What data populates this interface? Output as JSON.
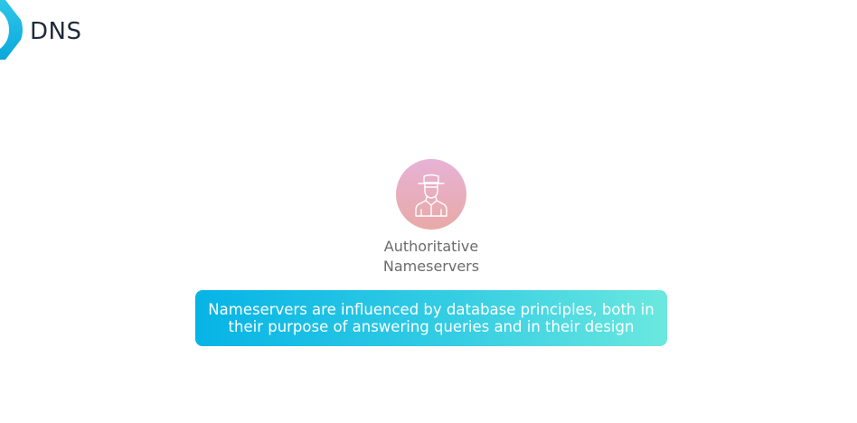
{
  "header": {
    "app_title": "DNS",
    "logo_icon": "chevron-logo-icon",
    "accent_color": "#19b8e6"
  },
  "node": {
    "icon": "spy-agent-icon",
    "label_line1": "Authoritative",
    "label_line2": "Nameservers",
    "circle_color": "#e8aec3"
  },
  "banner": {
    "line1": "Nameservers are influenced by database principles, both in",
    "line2": "their purpose of answering queries and in their design",
    "gradient_start": "#06b4e6",
    "gradient_end": "#6be8df"
  }
}
